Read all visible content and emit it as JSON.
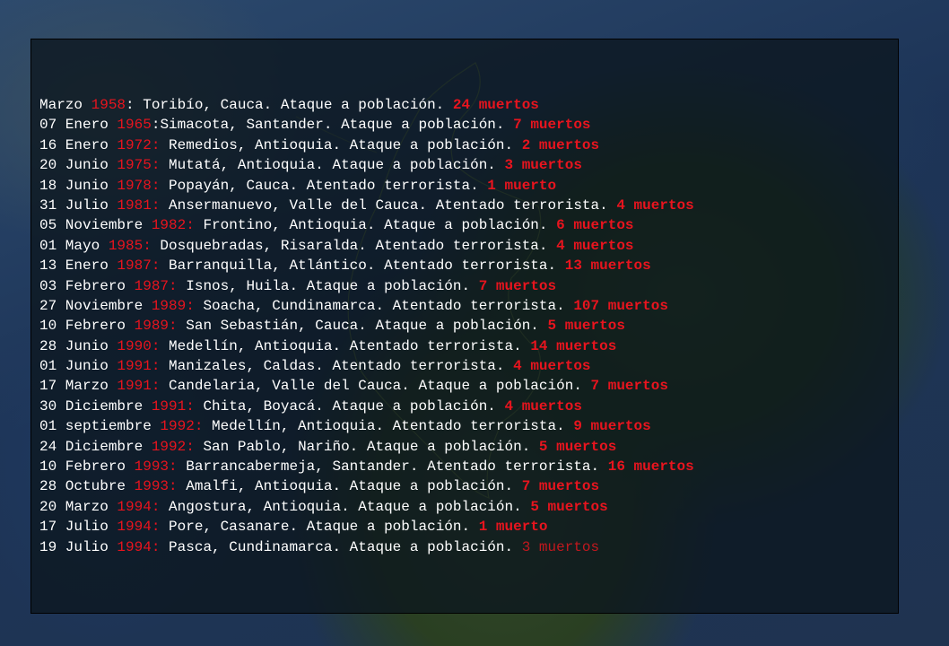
{
  "colors": {
    "text": "#ffffff",
    "highlight": "#e8141e",
    "panel": "rgba(12,22,30,0.78)"
  },
  "events": [
    {
      "date": "Marzo ",
      "year": "1958",
      "sep": ":",
      "text": " Toribío, Cauca. Ataque a población. ",
      "deaths": "24 muertos"
    },
    {
      "date": "07 Enero ",
      "year": "1965",
      "sep": ":",
      "text": "Simacota, Santander. Ataque a población. ",
      "deaths": "7 muertos"
    },
    {
      "date": "16 Enero ",
      "year": "1972:",
      "sep": "",
      "text": " Remedios, Antioquia. Ataque a población. ",
      "deaths": "2 muertos"
    },
    {
      "date": "20 Junio ",
      "year": "1975:",
      "sep": "",
      "text": " Mutatá, Antioquia. Ataque a población. ",
      "deaths": "3 muertos"
    },
    {
      "date": "18 Junio ",
      "year": "1978:",
      "sep": "",
      "text": " Popayán, Cauca. Atentado terrorista. ",
      "deaths": "1 muerto"
    },
    {
      "date": "31 Julio ",
      "year": "1981:",
      "sep": "",
      "text": " Ansermanuevo, Valle del Cauca. Atentado terrorista. ",
      "deaths": "4 muertos"
    },
    {
      "date": "05 Noviembre ",
      "year": "1982:",
      "sep": "",
      "text": " Frontino, Antioquia. Ataque a población. ",
      "deaths": "6 muertos"
    },
    {
      "date": "01 Mayo ",
      "year": "1985:",
      "sep": "",
      "text": " Dosquebradas, Risaralda. Atentado terrorista. ",
      "deaths": "4 muertos"
    },
    {
      "date": "13 Enero ",
      "year": "1987:",
      "sep": "",
      "text": " Barranquilla, Atlántico. Atentado terrorista. ",
      "deaths": "13 muertos"
    },
    {
      "date": "03 Febrero ",
      "year": "1987:",
      "sep": "",
      "text": " Isnos, Huila. Ataque a población. ",
      "deaths": "7 muertos"
    },
    {
      "date": "27 Noviembre ",
      "year": "1989:",
      "sep": "",
      "text": " Soacha, Cundinamarca. Atentado terrorista. ",
      "deaths": "107 muertos"
    },
    {
      "date": "10 Febrero ",
      "year": "1989:",
      "sep": "",
      "text": " San Sebastián, Cauca. Ataque a población. ",
      "deaths": "5 muertos"
    },
    {
      "date": "28 Junio ",
      "year": "1990:",
      "sep": "",
      "text": " Medellín, Antioquia. Atentado terrorista. ",
      "deaths": "14 muertos"
    },
    {
      "date": "01 Junio ",
      "year": "1991:",
      "sep": "",
      "text": " Manizales, Caldas. Atentado terrorista. ",
      "deaths": "4 muertos"
    },
    {
      "date": "17 Marzo ",
      "year": "1991:",
      "sep": "",
      "text": " Candelaria, Valle del Cauca. Ataque a población. ",
      "deaths": "7 muertos"
    },
    {
      "date": "30 Diciembre ",
      "year": "1991:",
      "sep": "",
      "text": " Chita, Boyacá. Ataque a población. ",
      "deaths": "4 muertos"
    },
    {
      "date": "01 septiembre ",
      "year": "1992:",
      "sep": "",
      "text": " Medellín, Antioquia. Atentado terrorista. ",
      "deaths": "9 muertos"
    },
    {
      "date": "24 Diciembre ",
      "year": "1992:",
      "sep": "",
      "text": " San Pablo, Nariño. Ataque a población. ",
      "deaths": "5 muertos"
    },
    {
      "date": "10 Febrero ",
      "year": "1993:",
      "sep": "",
      "text": " Barrancabermeja, Santander. Atentado terrorista. ",
      "deaths": "16 muertos"
    },
    {
      "date": "28 Octubre ",
      "year": "1993:",
      "sep": "",
      "text": " Amalfi, Antioquia. Ataque a población. ",
      "deaths": "7 muertos"
    },
    {
      "date": "20 Marzo ",
      "year": "1994:",
      "sep": "",
      "text": " Angostura, Antioquia. Ataque a población. ",
      "deaths": "5 muertos"
    },
    {
      "date": "17 Julio ",
      "year": "1994:",
      "sep": "",
      "text": " Pore, Casanare. Ataque a población. ",
      "deaths": "1 muerto"
    },
    {
      "date": "19 Julio ",
      "year": "1994:",
      "sep": "",
      "text": " Pasca, Cundinamarca. Ataque a población. ",
      "deaths": "3 muertos",
      "dim": true
    }
  ]
}
